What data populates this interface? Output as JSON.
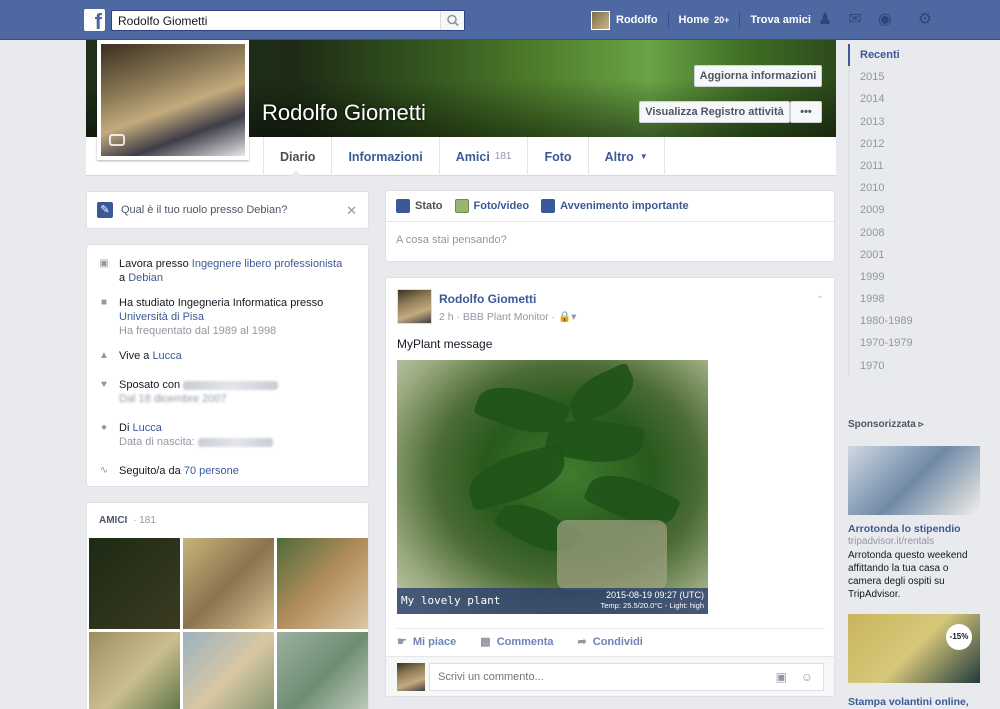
{
  "topbar": {
    "logo": "f",
    "search_value": "Rodolfo Giometti",
    "user_name": "Rodolfo",
    "home_label": "Home",
    "home_badge": "20+",
    "find_friends": "Trova amici"
  },
  "profile": {
    "name": "Rodolfo Giometti",
    "update_info": "Aggiorna informazioni",
    "activity_log": "Visualizza Registro attività",
    "more": "•••"
  },
  "tabs": [
    {
      "label": "Diario",
      "count": ""
    },
    {
      "label": "Informazioni",
      "count": ""
    },
    {
      "label": "Amici",
      "count": "181"
    },
    {
      "label": "Foto",
      "count": ""
    },
    {
      "label": "Altro",
      "count": ""
    }
  ],
  "role_prompt": "Qual è il tuo ruolo presso Debian?",
  "about": {
    "work_prefix": "Lavora presso ",
    "work_role": "Ingegnere libero professionista",
    "work_at": "a ",
    "work_company": "Debian",
    "study_prefix": "Ha studiato Ingegneria Informatica presso",
    "study_school": "Università di Pisa",
    "study_years": "Ha frequentato dal 1989 al 1998",
    "lives_prefix": "Vive a ",
    "lives_city": "Lucca",
    "married_prefix": "Sposato con ",
    "married_since": "Dal 18 dicembre 2007",
    "from_prefix": "Di ",
    "from_city": "Lucca",
    "birth_prefix": "Data di nascita: ",
    "followers_prefix": "Seguito/a da ",
    "followers_link": "70 persone"
  },
  "friends": {
    "title": "AMICI",
    "count": "181"
  },
  "composer": {
    "tabs": [
      "Stato",
      "Foto/video",
      "Avvenimento importante"
    ],
    "placeholder": "A cosa stai pensando?"
  },
  "post": {
    "author": "Rodolfo Giometti",
    "meta": "2 h · BBB Plant Monitor · ",
    "message": "MyPlant message",
    "caption_left": "My lovely plant",
    "caption_date": "2015-08-19 09:27 (UTC)",
    "caption_sensors": "Temp: 25.5/20.0°C - Light: high",
    "actions": [
      "Mi piace",
      "Commenta",
      "Condividi"
    ],
    "comment_placeholder": "Scrivi un commento..."
  },
  "years": [
    "Recenti",
    "2015",
    "2014",
    "2013",
    "2012",
    "2011",
    "2010",
    "2009",
    "2008",
    "2001",
    "1999",
    "1998",
    "1980-1989",
    "1970-1979",
    "1970"
  ],
  "sponsored": "Sponsorizzata",
  "ads": [
    {
      "title": "Arrotonda lo stipendio",
      "url": "tripadvisor.it/rentals",
      "text": "Arrotonda questo weekend affittando la tua casa o camera degli ospiti su TripAdvisor."
    },
    {
      "title": "Stampa volantini online, s...",
      "badge": "-15%"
    }
  ],
  "colors": {
    "topbar": "#4e69a2",
    "link": "#3b5998",
    "background": "#e9eaed"
  }
}
